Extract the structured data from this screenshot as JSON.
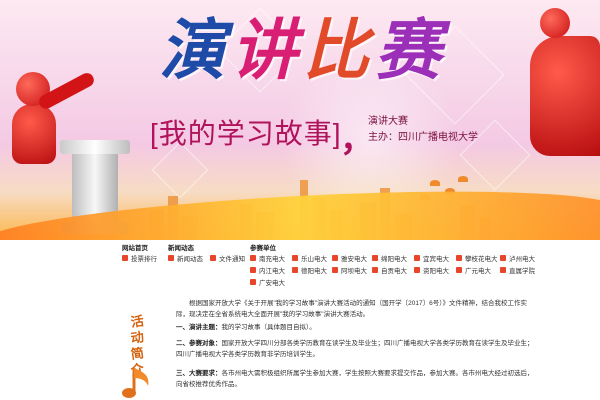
{
  "banner": {
    "title_chars": [
      "演",
      "讲",
      "比",
      "赛"
    ],
    "title_colors": [
      "#1e4aa8",
      "#d81f74",
      "#e24b2a",
      "#9b2fb8"
    ],
    "subtitle": "[我的学习故事]",
    "comma": "，",
    "contest_name": "演讲大赛",
    "organizer": "主办：四川广播电视大学"
  },
  "nav": {
    "columns": [
      {
        "header": "网站首页",
        "items": [
          "投票排行"
        ]
      },
      {
        "header": "新闻动态",
        "items": [
          "新闻动态"
        ]
      },
      {
        "header": "",
        "items": [
          "文件通知"
        ]
      },
      {
        "header": "参赛单位",
        "items": [
          "南充电大",
          "内江电大",
          "广安电大"
        ]
      },
      {
        "header": "",
        "items": [
          "乐山电大",
          "德阳电大"
        ]
      },
      {
        "header": "",
        "items": [
          "雅安电大",
          "阿坝电大"
        ]
      },
      {
        "header": "",
        "items": [
          "绵阳电大",
          "自贡电大"
        ]
      },
      {
        "header": "",
        "items": [
          "宜宾电大",
          "资阳电大"
        ]
      },
      {
        "header": "",
        "items": [
          "攀枝花电大",
          "广元电大"
        ]
      },
      {
        "header": "",
        "items": [
          "泸州电大",
          "直属学院"
        ]
      }
    ]
  },
  "intro": {
    "side_title": [
      "活",
      "动",
      "简",
      "介"
    ],
    "paragraph": "根据国家开放大学《关于开展\"我的学习故事\"演讲大赛活动的通知（国开学〔2017〕6号）》文件精神，结合我校工作实际，现决定在全省系统电大全面开展\"我的学习故事\"演讲大赛活动。",
    "items": [
      {
        "label": "一、演讲主题：",
        "text": "我的学习故事（具体题目自拟）。"
      },
      {
        "label": "二、参赛对象：",
        "text": "国家开放大学四川分部各类学历教育在读学生及毕业生；四川广播电视大学各类学历教育在读学生及毕业生；四川广播电视大学各类学历教育非学历培训学生。"
      },
      {
        "label": "三、大赛要求：",
        "text": "各市州电大需积极组织所属学生参加大赛，学生按照大赛要求提交作品，参加大赛。各市州电大经过初选后，向省校推荐优秀作品。"
      }
    ]
  }
}
